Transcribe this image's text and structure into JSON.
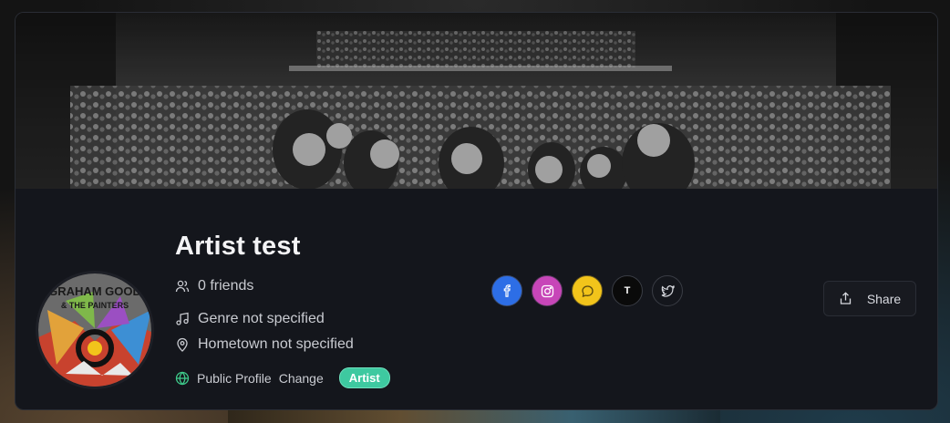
{
  "profile": {
    "name": "Artist test",
    "friends": "0 friends",
    "genre": "Genre not specified",
    "hometown": "Hometown not specified",
    "visibility": "Public Profile",
    "change_label": "Change",
    "role_badge": "Artist",
    "avatar_text_top": "GRAHAM GOOD",
    "avatar_text_mid": "& THE PAINTERS"
  },
  "socials": [
    {
      "name": "facebook",
      "icon": "facebook-icon",
      "color": "#2d6ee6"
    },
    {
      "name": "instagram",
      "icon": "instagram-icon",
      "color": "#c746b8"
    },
    {
      "name": "chat",
      "icon": "chat-bubble-icon",
      "color": "#f2c41b"
    },
    {
      "name": "tiktok",
      "icon": "tiktok-icon",
      "label": "T",
      "color": "#0a0a0a"
    },
    {
      "name": "twitter",
      "icon": "twitter-icon",
      "color": "#14161c"
    }
  ],
  "actions": {
    "share_label": "Share"
  },
  "colors": {
    "card_bg": "#14161c",
    "badge": "#3ec9a0",
    "globe_icon": "#3ec98a"
  }
}
